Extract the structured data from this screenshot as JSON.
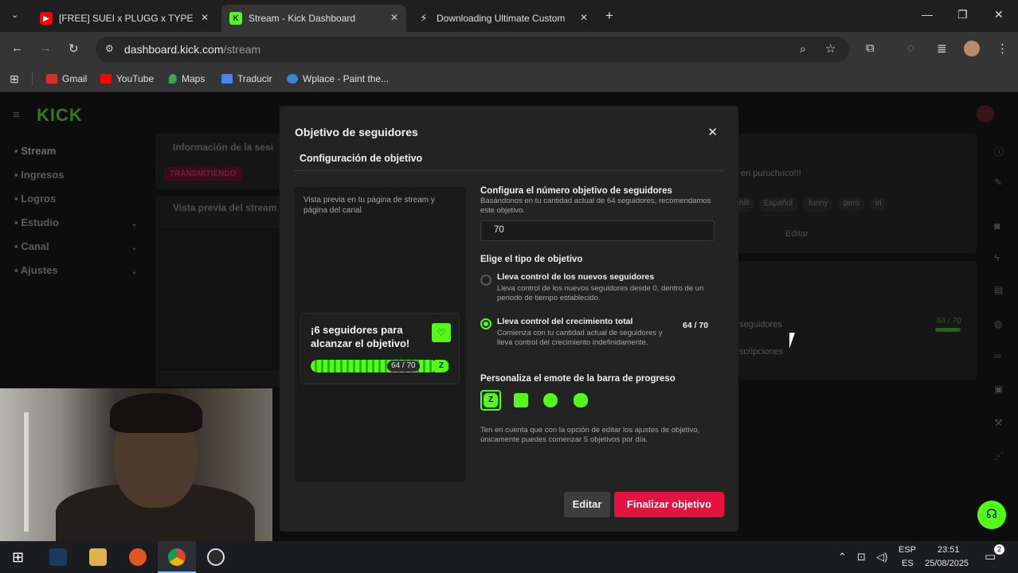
{
  "browser": {
    "tabs": [
      {
        "title": "[FREE] SUEI x PLUGG x TYPE BEA",
        "icon": "youtube-icon"
      },
      {
        "title": "Stream - Kick Dashboard",
        "icon": "kick-icon"
      },
      {
        "title": "Downloading Ultimate Custom",
        "icon": "download-page-icon"
      }
    ],
    "url_host": "dashboard.kick.com",
    "url_path": "/stream",
    "bookmarks": [
      "Gmail",
      "YouTube",
      "Maps",
      "Traducir",
      "Wplace - Paint the..."
    ]
  },
  "sidebar": {
    "logo": "KICK",
    "items": [
      "Stream",
      "Ingresos",
      "Logros",
      "Estudio",
      "Canal",
      "Ajustes"
    ]
  },
  "background": {
    "session_title": "Información de la sesi",
    "status_badge": "TRANSMITIENDO",
    "preview_title": "Vista previa del stream",
    "stream_title_snippet": "en puruchuco!!!",
    "tags": [
      "chill",
      "Español",
      "funny",
      "peru",
      "irl"
    ],
    "edit_label": "Editar",
    "goal_label": "seguidores",
    "goal_count": "64 / 70",
    "subs_label": "scripciones"
  },
  "modal": {
    "title": "Objetivo de seguidores",
    "section": "Configuración de objetivo",
    "preview_text": "Vista previa en tu página de stream y página del canal",
    "card_text": "¡6 seguidores para alcanzar el objetivo!",
    "card_count": "64 / 70",
    "card_progress": 0.914,
    "target_label": "Configura el número objetivo de seguidores",
    "target_help": "Basándonos en tu cantidad actual de 64 seguidores, recomendamos este objetivo.",
    "target_value": "70",
    "type_label": "Elige el tipo de objetivo",
    "option1_title": "Lleva control de los nuevos seguidores",
    "option1_desc": "Lleva control de los nuevos seguidores desde 0, dentro de un periodo de tiempo establecido.",
    "option2_title": "Lleva control del crecimiento total",
    "option2_desc": "Comienza con tu cantidad actual de seguidores y lleva control del crecimiento indefinidamente.",
    "option2_count": "64 / 70",
    "selected_option": 2,
    "emote_label": "Personaliza el emote de la barra de progreso",
    "note": "Ten en cuenta que con la opción de editar los ajustes de objetivo, únicamente puedes comenzar 5 objetivos por día.",
    "edit_button": "Editar",
    "finish_button": "Finalizar objetivo"
  },
  "taskbar": {
    "lang_top": "ESP",
    "lang_bottom": "ES",
    "time": "23:51",
    "date": "25/08/2025",
    "notifications": "2"
  },
  "colors": {
    "kick_green": "#53fc18",
    "finish_red": "#e2143f"
  }
}
